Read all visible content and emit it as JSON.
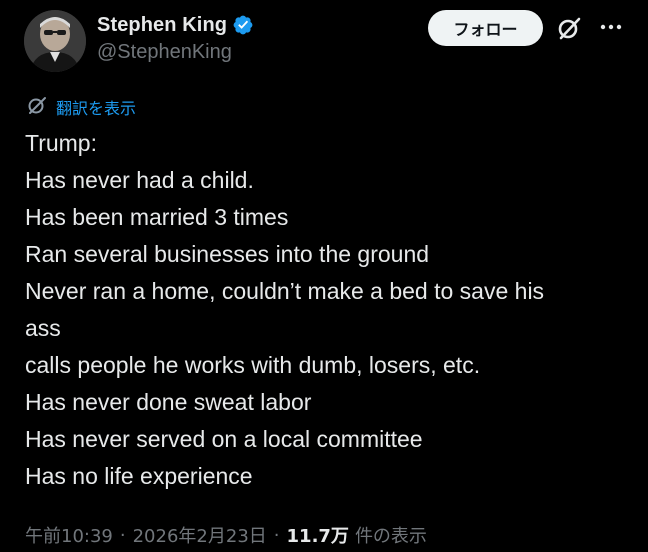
{
  "author": {
    "display_name": "Stephen King",
    "handle": "@StephenKing",
    "verified_icon": "verified-badge-icon"
  },
  "actions": {
    "follow_label": "フォロー",
    "grok_icon": "grok-icon",
    "more_icon": "more-dots-icon"
  },
  "translate": {
    "icon": "globe-translate-icon",
    "label": "翻訳を表示"
  },
  "tweet": {
    "lines": [
      "Trump:",
      "Has never had a child.",
      "Has been married 3 times",
      "Ran several businesses into the ground",
      "Never ran a home, couldn’t make a bed to save his",
      "ass",
      "calls people he works with dumb, losers, etc.",
      "Has never done sweat labor",
      "Has never served on a local committee",
      "Has no life experience"
    ]
  },
  "meta": {
    "time": "午前10:39",
    "separator": "·",
    "date": "2026年2月23日",
    "views_count": "11.7万",
    "views_label": "件の表示"
  },
  "colors": {
    "background": "#000000",
    "text": "#e7e9ea",
    "secondary": "#71767b",
    "link": "#1d9bf0",
    "verified": "#1d9bf0",
    "follow_bg": "#eff3f4"
  }
}
